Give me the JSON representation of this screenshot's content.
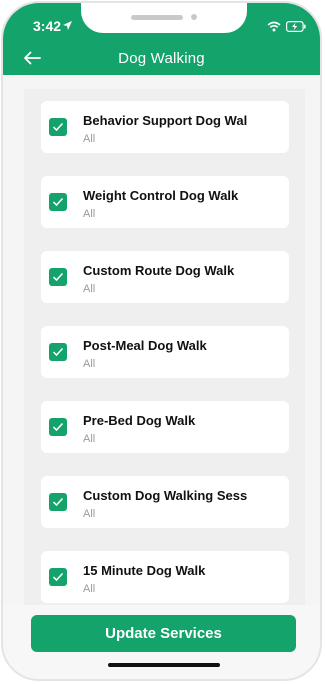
{
  "status_bar": {
    "time": "3:42"
  },
  "header": {
    "title": "Dog Walking"
  },
  "services": [
    {
      "title": "Behavior Support Dog Walk",
      "subtitle": "All",
      "checked": true
    },
    {
      "title": "Weight Control Dog Walk",
      "subtitle": "All",
      "checked": true
    },
    {
      "title": "Custom Route Dog Walk",
      "subtitle": "All",
      "checked": true
    },
    {
      "title": "Post-Meal Dog Walk",
      "subtitle": "All",
      "checked": true
    },
    {
      "title": "Pre-Bed Dog Walk",
      "subtitle": "All",
      "checked": true
    },
    {
      "title": "Custom Dog Walking Session",
      "subtitle": "All",
      "checked": true
    },
    {
      "title": "15 Minute Dog Walk",
      "subtitle": "All",
      "checked": true
    }
  ],
  "footer": {
    "button_label": "Update Services"
  },
  "colors": {
    "accent": "#14a36b",
    "background": "#f5f5f5"
  },
  "icons": [
    "location-arrow-icon",
    "wifi-icon",
    "battery-charging-icon",
    "back-arrow-icon",
    "checkmark-icon"
  ]
}
